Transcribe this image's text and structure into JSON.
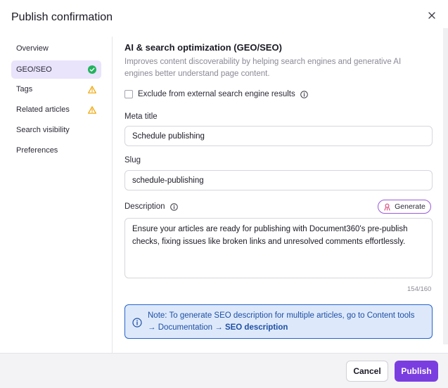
{
  "dialog": {
    "title": "Publish confirmation",
    "close_icon": "close-icon"
  },
  "sidebar": {
    "items": [
      {
        "label": "Overview",
        "status": "none"
      },
      {
        "label": "GEO/SEO",
        "status": "success",
        "active": true
      },
      {
        "label": "Tags",
        "status": "warning"
      },
      {
        "label": "Related articles",
        "status": "warning"
      },
      {
        "label": "Search visibility",
        "status": "none"
      },
      {
        "label": "Preferences",
        "status": "none"
      }
    ]
  },
  "main": {
    "section_title": "AI & search optimization (GEO/SEO)",
    "section_description": "Improves content discoverability by helping search engines and generative AI engines better understand page content.",
    "exclude_checkbox": {
      "label": "Exclude from external search engine results",
      "checked": false
    },
    "meta_title": {
      "label": "Meta title",
      "value": "Schedule publishing"
    },
    "slug": {
      "label": "Slug",
      "value": "schedule-publishing"
    },
    "description": {
      "label": "Description",
      "generate_label": "Generate",
      "value": "Ensure your articles are ready for publishing with Document360's pre-publish checks, fixing issues like broken links and unresolved comments effortlessly.",
      "counter": "154/160"
    },
    "note": {
      "text_before": "Note: To generate SEO description for multiple articles, go to Content tools → Documentation → ",
      "link": "SEO description"
    }
  },
  "footer": {
    "cancel_label": "Cancel",
    "publish_label": "Publish"
  },
  "colors": {
    "accent": "#7a3ee0",
    "success": "#22b35e",
    "warning": "#f0a400",
    "note_border": "#2563c9",
    "note_bg": "#dde9fb"
  }
}
